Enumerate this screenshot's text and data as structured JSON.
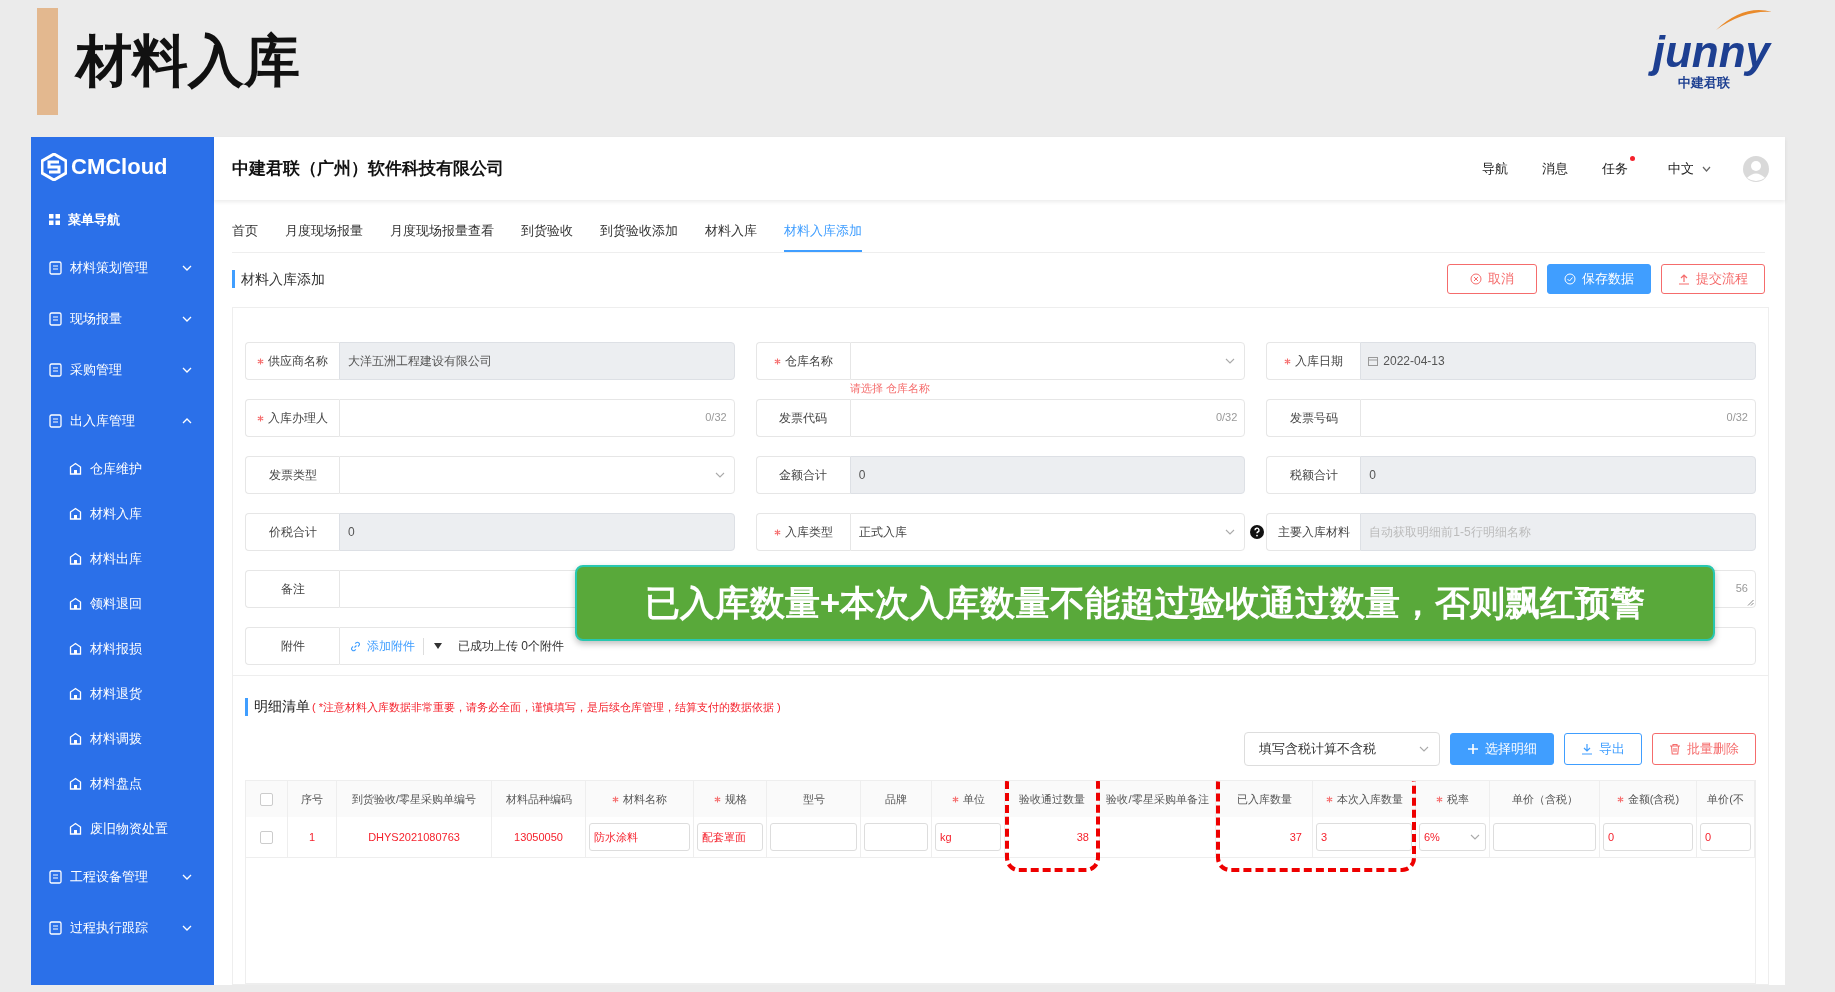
{
  "slide": {
    "title": "材料入库",
    "logo_word": "junny",
    "logo_caption": "中建君联"
  },
  "sidebar": {
    "brand": "CMCloud",
    "items": [
      {
        "label": "菜单导航",
        "kind": "link"
      },
      {
        "label": "材料策划管理",
        "kind": "group",
        "expanded": false
      },
      {
        "label": "现场报量",
        "kind": "group",
        "expanded": false
      },
      {
        "label": "采购管理",
        "kind": "group",
        "expanded": false
      },
      {
        "label": "出入库管理",
        "kind": "group",
        "expanded": true,
        "children": [
          {
            "label": "仓库维护"
          },
          {
            "label": "材料入库"
          },
          {
            "label": "材料出库"
          },
          {
            "label": "领料退回"
          },
          {
            "label": "材料报损"
          },
          {
            "label": "材料退货"
          },
          {
            "label": "材料调拨"
          },
          {
            "label": "材料盘点"
          },
          {
            "label": "废旧物资处置"
          }
        ]
      },
      {
        "label": "工程设备管理",
        "kind": "group",
        "expanded": false
      },
      {
        "label": "过程执行跟踪",
        "kind": "group",
        "expanded": false
      }
    ]
  },
  "header": {
    "company": "中建君联（广州）软件科技有限公司",
    "nav": [
      {
        "label": "导航",
        "dot": false
      },
      {
        "label": "消息",
        "dot": false
      },
      {
        "label": "任务",
        "dot": true
      }
    ],
    "language": "中文"
  },
  "tabs": [
    {
      "label": "首页",
      "selected": false
    },
    {
      "label": "月度现场报量",
      "selected": false
    },
    {
      "label": "月度现场报量查看",
      "selected": false
    },
    {
      "label": "到货验收",
      "selected": false
    },
    {
      "label": "到货验收添加",
      "selected": false
    },
    {
      "label": "材料入库",
      "selected": false
    },
    {
      "label": "材料入库添加",
      "selected": true
    }
  ],
  "page": {
    "title": "材料入库添加",
    "buttons": [
      {
        "label": "取消",
        "kind": "cancel"
      },
      {
        "label": "保存数据",
        "kind": "save"
      },
      {
        "label": "提交流程",
        "kind": "submit"
      }
    ]
  },
  "form": {
    "fields": [
      {
        "label": "供应商名称",
        "required": true,
        "disabled": true,
        "kind": "input",
        "value": "大洋五洲工程建设有限公司"
      },
      {
        "label": "仓库名称",
        "required": true,
        "disabled": false,
        "kind": "select",
        "error": "请选择 仓库名称"
      },
      {
        "label": "入库日期",
        "required": true,
        "disabled": true,
        "kind": "date",
        "value": "2022-04-13"
      },
      {
        "label": "入库办理人",
        "required": true,
        "disabled": false,
        "kind": "input",
        "counter": "0/32"
      },
      {
        "label": "发票代码",
        "required": false,
        "disabled": false,
        "kind": "input",
        "counter": "0/32"
      },
      {
        "label": "发票号码",
        "required": false,
        "disabled": false,
        "kind": "input",
        "counter": "0/32"
      },
      {
        "label": "发票类型",
        "required": false,
        "disabled": false,
        "kind": "select"
      },
      {
        "label": "金额合计",
        "required": false,
        "disabled": true,
        "kind": "input",
        "value": "0"
      },
      {
        "label": "税额合计",
        "required": false,
        "disabled": true,
        "kind": "input",
        "value": "0"
      },
      {
        "label": "价税合计",
        "required": false,
        "disabled": true,
        "kind": "input",
        "value": "0"
      },
      {
        "label": "入库类型",
        "required": true,
        "disabled": false,
        "kind": "select",
        "value": "正式入库",
        "help": true
      },
      {
        "label": "主要入库材料",
        "required": false,
        "disabled": true,
        "kind": "input",
        "placeholder": "自动获取明细前1-5行明细名称"
      },
      {
        "label": "备注",
        "required": false,
        "disabled": false,
        "kind": "textarea",
        "counter": "56"
      },
      {
        "label": "附件",
        "required": false,
        "disabled": false,
        "kind": "attachment",
        "link": "添加附件",
        "status": "已成功上传 0个附件"
      }
    ]
  },
  "banner": {
    "text": "已入库数量+本次入库数量不能超过验收通过数量，否则飘红预警"
  },
  "details": {
    "title": "明细清单",
    "note": "( *注意材料入库数据非常重要，请务必全面，谨慎填写，是后续仓库管理，结算支付的数据依据 )",
    "tax_mode": "填写含税计算不含税",
    "buttons": [
      {
        "label": "选择明细",
        "kind": "primary"
      },
      {
        "label": "导出",
        "kind": "outline"
      },
      {
        "label": "批量删除",
        "kind": "danger"
      }
    ],
    "select_all": {
      "checked": false
    },
    "columns": [
      {
        "label": "序号",
        "required": false,
        "highlight": false
      },
      {
        "label": "到货验收/零星采购单编号",
        "required": false,
        "highlight": false
      },
      {
        "label": "材料品种编码",
        "required": false,
        "highlight": false
      },
      {
        "label": "材料名称",
        "required": true,
        "highlight": false
      },
      {
        "label": "规格",
        "required": true,
        "highlight": false
      },
      {
        "label": "型号",
        "required": false,
        "highlight": false
      },
      {
        "label": "品牌",
        "required": false,
        "highlight": false
      },
      {
        "label": "单位",
        "required": true,
        "highlight": false
      },
      {
        "label": "验收通过数量",
        "required": false,
        "highlight": true
      },
      {
        "label": "验收/零星采购单备注",
        "required": false,
        "highlight": false
      },
      {
        "label": "已入库数量",
        "required": false,
        "highlight": true
      },
      {
        "label": "本次入库数量",
        "required": true,
        "highlight": true
      },
      {
        "label": "税率",
        "required": true,
        "highlight": false
      },
      {
        "label": "单价（含税）",
        "required": false,
        "highlight": false
      },
      {
        "label": "金额(含税)",
        "required": true,
        "highlight": false
      },
      {
        "label": "单价(不",
        "required": false,
        "highlight": false
      }
    ],
    "rows": [
      {
        "checked": false,
        "warning": true,
        "cells": [
          {
            "kind": "text",
            "value": "1"
          },
          {
            "kind": "text",
            "value": "DHYS2021080763"
          },
          {
            "kind": "text",
            "value": "13050050"
          },
          {
            "kind": "input",
            "value": "防水涂料"
          },
          {
            "kind": "input",
            "value": "配套罩面"
          },
          {
            "kind": "input"
          },
          {
            "kind": "input"
          },
          {
            "kind": "input",
            "value": "kg"
          },
          {
            "kind": "number",
            "value": "38"
          },
          {
            "kind": "text"
          },
          {
            "kind": "number",
            "value": "37"
          },
          {
            "kind": "input",
            "value": "3"
          },
          {
            "kind": "select",
            "value": "6%"
          },
          {
            "kind": "input"
          },
          {
            "kind": "input",
            "value": "0"
          },
          {
            "kind": "input",
            "value": "0"
          }
        ]
      }
    ]
  }
}
